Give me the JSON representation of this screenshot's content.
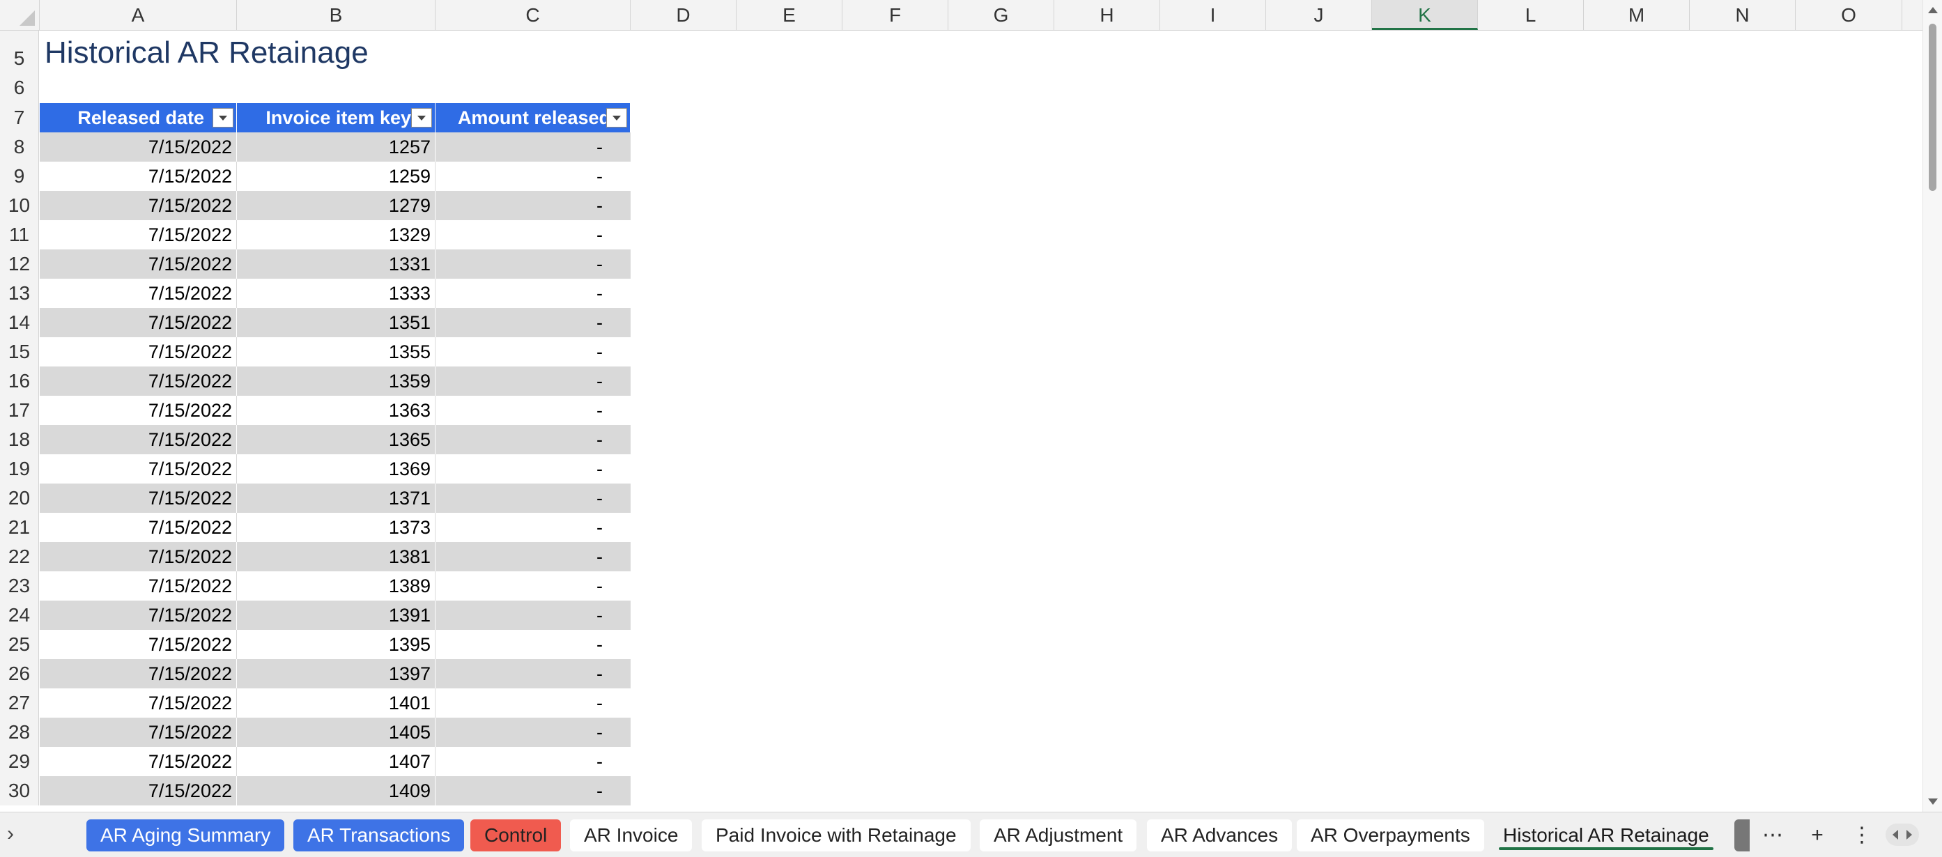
{
  "columns": [
    "A",
    "B",
    "C",
    "D",
    "E",
    "F",
    "G",
    "H",
    "I",
    "J",
    "K",
    "L",
    "M",
    "N",
    "O"
  ],
  "selected_column": "K",
  "sheet_title": "Historical AR Retainage",
  "table": {
    "headers": [
      "Released date",
      "Invoice item key",
      "Amount released"
    ],
    "rows": [
      {
        "row": "8",
        "date": "7/15/2022",
        "key": "1257",
        "amount": "-"
      },
      {
        "row": "9",
        "date": "7/15/2022",
        "key": "1259",
        "amount": "-"
      },
      {
        "row": "10",
        "date": "7/15/2022",
        "key": "1279",
        "amount": "-"
      },
      {
        "row": "11",
        "date": "7/15/2022",
        "key": "1329",
        "amount": "-"
      },
      {
        "row": "12",
        "date": "7/15/2022",
        "key": "1331",
        "amount": "-"
      },
      {
        "row": "13",
        "date": "7/15/2022",
        "key": "1333",
        "amount": "-"
      },
      {
        "row": "14",
        "date": "7/15/2022",
        "key": "1351",
        "amount": "-"
      },
      {
        "row": "15",
        "date": "7/15/2022",
        "key": "1355",
        "amount": "-"
      },
      {
        "row": "16",
        "date": "7/15/2022",
        "key": "1359",
        "amount": "-"
      },
      {
        "row": "17",
        "date": "7/15/2022",
        "key": "1363",
        "amount": "-"
      },
      {
        "row": "18",
        "date": "7/15/2022",
        "key": "1365",
        "amount": "-"
      },
      {
        "row": "19",
        "date": "7/15/2022",
        "key": "1369",
        "amount": "-"
      },
      {
        "row": "20",
        "date": "7/15/2022",
        "key": "1371",
        "amount": "-"
      },
      {
        "row": "21",
        "date": "7/15/2022",
        "key": "1373",
        "amount": "-"
      },
      {
        "row": "22",
        "date": "7/15/2022",
        "key": "1381",
        "amount": "-"
      },
      {
        "row": "23",
        "date": "7/15/2022",
        "key": "1389",
        "amount": "-"
      },
      {
        "row": "24",
        "date": "7/15/2022",
        "key": "1391",
        "amount": "-"
      },
      {
        "row": "25",
        "date": "7/15/2022",
        "key": "1395",
        "amount": "-"
      },
      {
        "row": "26",
        "date": "7/15/2022",
        "key": "1397",
        "amount": "-"
      },
      {
        "row": "27",
        "date": "7/15/2022",
        "key": "1401",
        "amount": "-"
      },
      {
        "row": "28",
        "date": "7/15/2022",
        "key": "1405",
        "amount": "-"
      },
      {
        "row": "29",
        "date": "7/15/2022",
        "key": "1407",
        "amount": "-"
      },
      {
        "row": "30",
        "date": "7/15/2022",
        "key": "1409",
        "amount": "-"
      }
    ]
  },
  "row_labels_top": [
    "5",
    "6",
    "7"
  ],
  "tabs": [
    {
      "label": "AR Aging Summary",
      "style": "blue"
    },
    {
      "label": "AR Transactions",
      "style": "blue"
    },
    {
      "label": "Control",
      "style": "red"
    },
    {
      "label": "AR Invoice",
      "style": "plain"
    },
    {
      "label": "Paid Invoice with Retainage",
      "style": "plain"
    },
    {
      "label": "AR Adjustment",
      "style": "plain"
    },
    {
      "label": "AR Advances",
      "style": "plain"
    },
    {
      "label": "AR Overpayments",
      "style": "plain"
    },
    {
      "label": "Historical AR Retainage",
      "style": "active"
    }
  ],
  "tabbar_icons": [
    "ellipsis-icon",
    "add-sheet-icon",
    "more-options-icon"
  ],
  "colors": {
    "header_blue": "#2f6ce5",
    "tab_blue": "#3e73e6",
    "tab_red": "#f05b4f",
    "active_underline": "#217346",
    "title_color": "#1f3864"
  }
}
